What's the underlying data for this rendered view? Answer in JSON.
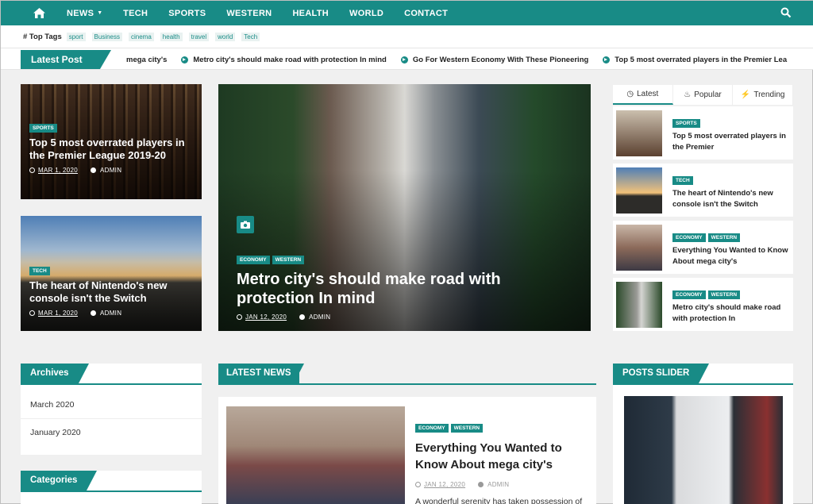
{
  "nav": {
    "items": [
      "NEWS",
      "TECH",
      "SPORTS",
      "WESTERN",
      "HEALTH",
      "WORLD",
      "CONTACT"
    ]
  },
  "top_tags": {
    "label": "# Top Tags",
    "tags": [
      "sport",
      "Business",
      "cinema",
      "health",
      "travel",
      "world",
      "Tech"
    ]
  },
  "latest_post": {
    "label": "Latest Post",
    "items": [
      "mega city's",
      "Metro city's should make road with protection In mind",
      "Go For Western Economy With These Pioneering",
      "Top 5 most overrated players in the Premier Lea"
    ]
  },
  "featured": [
    {
      "category": "SPORTS",
      "title": "Top 5 most overrated players in the Premier League 2019-20",
      "date": "MAR 1, 2020",
      "author": "ADMIN"
    },
    {
      "category": "TECH",
      "title": "The heart of Nintendo's new console isn't the Switch",
      "date": "MAR 1, 2020",
      "author": "ADMIN"
    }
  ],
  "hero": {
    "categories": [
      "ECONOMY",
      "WESTERN"
    ],
    "title": "Metro city's should make road with protection In mind",
    "date": "JAN 12, 2020",
    "author": "ADMIN"
  },
  "sidebar_tabs": [
    "Latest",
    "Popular",
    "Trending"
  ],
  "sidebar_posts": [
    {
      "categories": [
        "SPORTS"
      ],
      "title": "Top 5 most overrated players in the Premier"
    },
    {
      "categories": [
        "TECH"
      ],
      "title": "The heart of Nintendo's new console isn't the Switch"
    },
    {
      "categories": [
        "ECONOMY",
        "WESTERN"
      ],
      "title": "Everything You Wanted to Know About mega city's"
    },
    {
      "categories": [
        "ECONOMY",
        "WESTERN"
      ],
      "title": "Metro city's should make road with protection In"
    }
  ],
  "archives": {
    "title": "Archives",
    "items": [
      "March 2020",
      "January 2020"
    ]
  },
  "categories_widget": {
    "title": "Categories"
  },
  "latest_news": {
    "title": "LATEST NEWS"
  },
  "news_post": {
    "categories": [
      "ECONOMY",
      "WESTERN"
    ],
    "title": "Everything You Wanted to Know About mega city's",
    "date": "JAN 12, 2020",
    "author": "ADMIN",
    "excerpt": "A wonderful serenity has taken possession of"
  },
  "posts_slider": {
    "title": "POSTS SLIDER"
  },
  "colors": {
    "accent": "#188b86"
  }
}
